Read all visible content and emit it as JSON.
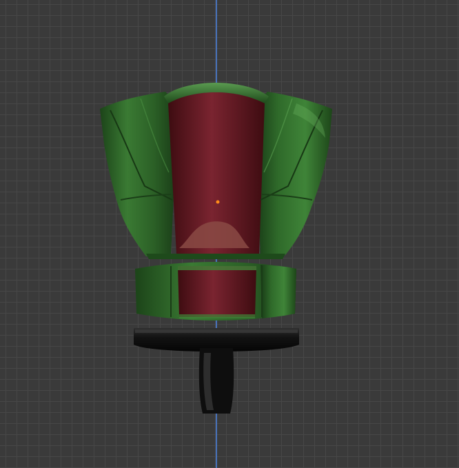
{
  "viewport": {
    "view": "3d-viewport",
    "grid": true,
    "axis": "z-axis",
    "axis_color": "#4a78c8",
    "background_color": "#3a3a3a",
    "grid_color": "#474747"
  },
  "model": {
    "parts": [
      "torso-upper",
      "torso-waist",
      "base-stand"
    ],
    "colors": {
      "armor_green": "#2f6a2a",
      "inner_red": "#6e1a22",
      "base_black": "#161616",
      "origin": "#ff8c1a"
    }
  }
}
